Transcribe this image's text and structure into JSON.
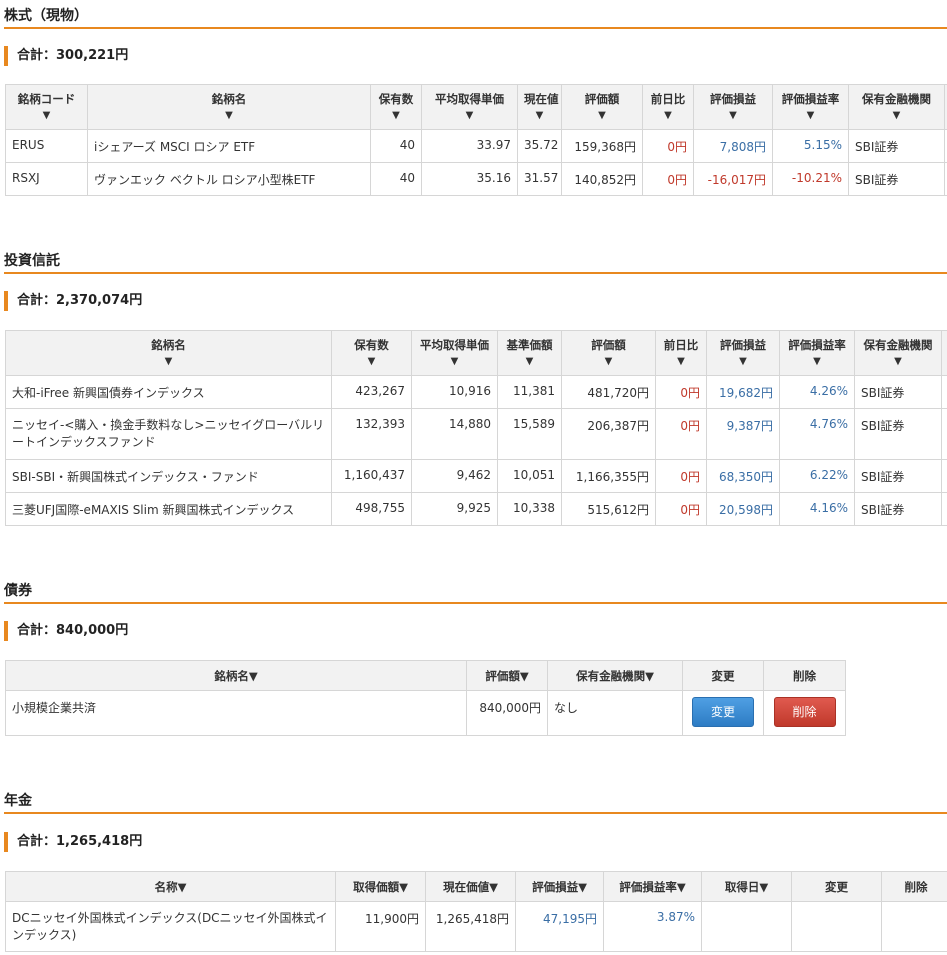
{
  "stocks": {
    "title": "株式（現物）",
    "total": "合計：300,221円",
    "headers": [
      "銘柄コード",
      "銘柄名",
      "保有数",
      "平均取得単価",
      "現在値",
      "評価額",
      "前日比",
      "評価損益",
      "評価損益率",
      "保有金融機関"
    ],
    "rows": [
      [
        "ERUS",
        "iシェアーズ MSCI ロシア ETF",
        "40",
        "33.97",
        "35.72",
        "159,368円",
        "0円",
        "7,808円",
        "5.15%",
        "SBI証券"
      ],
      [
        "RSXJ",
        "ヴァンエック ベクトル ロシア小型株ETF",
        "40",
        "35.16",
        "31.57",
        "140,852円",
        "0円",
        "-16,017円",
        "-10.21%",
        "SBI証券"
      ]
    ]
  },
  "funds": {
    "title": "投資信託",
    "total": "合計：2,370,074円",
    "headers": [
      "銘柄名",
      "保有数",
      "平均取得単価",
      "基準価額",
      "評価額",
      "前日比",
      "評価損益",
      "評価損益率",
      "保有金融機関"
    ],
    "rows": [
      [
        "大和-iFree 新興国債券インデックス",
        "423,267",
        "10,916",
        "11,381",
        "481,720円",
        "0円",
        "19,682円",
        "4.26%",
        "SBI証券"
      ],
      [
        "ニッセイ-<購入・換金手数料なし>ニッセイグローバルリートインデックスファンド",
        "132,393",
        "14,880",
        "15,589",
        "206,387円",
        "0円",
        "9,387円",
        "4.76%",
        "SBI証券"
      ],
      [
        "SBI-SBI・新興国株式インデックス・ファンド",
        "1,160,437",
        "9,462",
        "10,051",
        "1,166,355円",
        "0円",
        "68,350円",
        "6.22%",
        "SBI証券"
      ],
      [
        "三菱UFJ国際-eMAXIS Slim 新興国株式インデックス",
        "498,755",
        "9,925",
        "10,338",
        "515,612円",
        "0円",
        "20,598円",
        "4.16%",
        "SBI証券"
      ]
    ]
  },
  "bonds": {
    "title": "債券",
    "total": "合計：840,000円",
    "headers": [
      "銘柄名▼",
      "評価額▼",
      "保有金融機関▼",
      "変更",
      "削除"
    ],
    "rows": [
      {
        "name": "小規模企業共済",
        "value": "840,000円",
        "institution": "なし",
        "edit": "変更",
        "delete": "削除"
      }
    ]
  },
  "pension": {
    "title": "年金",
    "total": "合計：1,265,418円",
    "headers": [
      "名称▼",
      "取得価額▼",
      "現在価値▼",
      "評価損益▼",
      "評価損益率▼",
      "取得日▼",
      "変更",
      "削除"
    ],
    "rows": [
      [
        "DCニッセイ外国株式インデックス(DCニッセイ外国株式インデックス)",
        "11,900円",
        "1,265,418円",
        "47,195円",
        "3.87%",
        "",
        "",
        ""
      ]
    ]
  },
  "sort_arrow": "▼",
  "colors": {
    "accent": "#e8881f",
    "negative": "#c0392b",
    "positive": "#3a6ea5"
  }
}
